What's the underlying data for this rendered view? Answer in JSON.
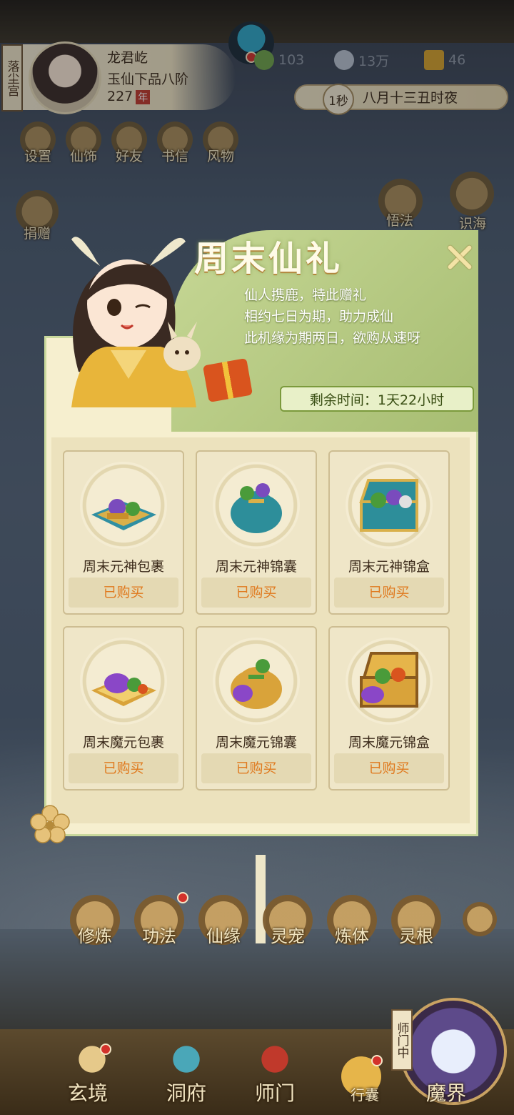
{
  "status": {
    "location_tag": "落尘宫",
    "player_name": "龙君屹",
    "player_rank": "玉仙下品八阶",
    "player_age": "227",
    "age_unit": "年",
    "currency_1": "103",
    "currency_2": "13万",
    "currency_3": "46",
    "speed": "1秒",
    "game_time": "八月十三丑时夜"
  },
  "top_menu": [
    {
      "label": "设置",
      "icon": "gear-icon"
    },
    {
      "label": "仙饰",
      "icon": "robe-icon"
    },
    {
      "label": "好友",
      "icon": "friends-icon"
    },
    {
      "label": "书信",
      "icon": "letter-icon"
    },
    {
      "label": "风物",
      "icon": "scroll-icon"
    }
  ],
  "side_menu": {
    "left": "捐赠",
    "right_1": "悟法",
    "right_2": "识海"
  },
  "popup": {
    "title": "周末仙礼",
    "desc": [
      "仙人携鹿，特此赠礼",
      "相约七日为期，助力成仙",
      "此机缘为期两日，欲购从速呀"
    ],
    "timer_label": "剩余时间：",
    "timer_value": "1天22小时",
    "items": [
      {
        "name": "周末元神包裹",
        "status": "已购买"
      },
      {
        "name": "周末元神锦囊",
        "status": "已购买"
      },
      {
        "name": "周末元神锦盒",
        "status": "已购买"
      },
      {
        "name": "周末魔元包裹",
        "status": "已购买"
      },
      {
        "name": "周末魔元锦囊",
        "status": "已购买"
      },
      {
        "name": "周末魔元锦盒",
        "status": "已购买"
      }
    ]
  },
  "action_row": [
    "修炼",
    "功法",
    "仙缘",
    "灵宠",
    "炼体",
    "灵根"
  ],
  "nav": {
    "tab_1": "玄境",
    "tab_2": "洞府",
    "tab_3": "师门",
    "tab_4": "行囊",
    "tab_5": "魔界",
    "shimen_tag": "师门中"
  },
  "colors": {
    "accent_green": "#a7bd72",
    "bought_orange": "#e07a1f",
    "badge_red": "#d3322b"
  }
}
